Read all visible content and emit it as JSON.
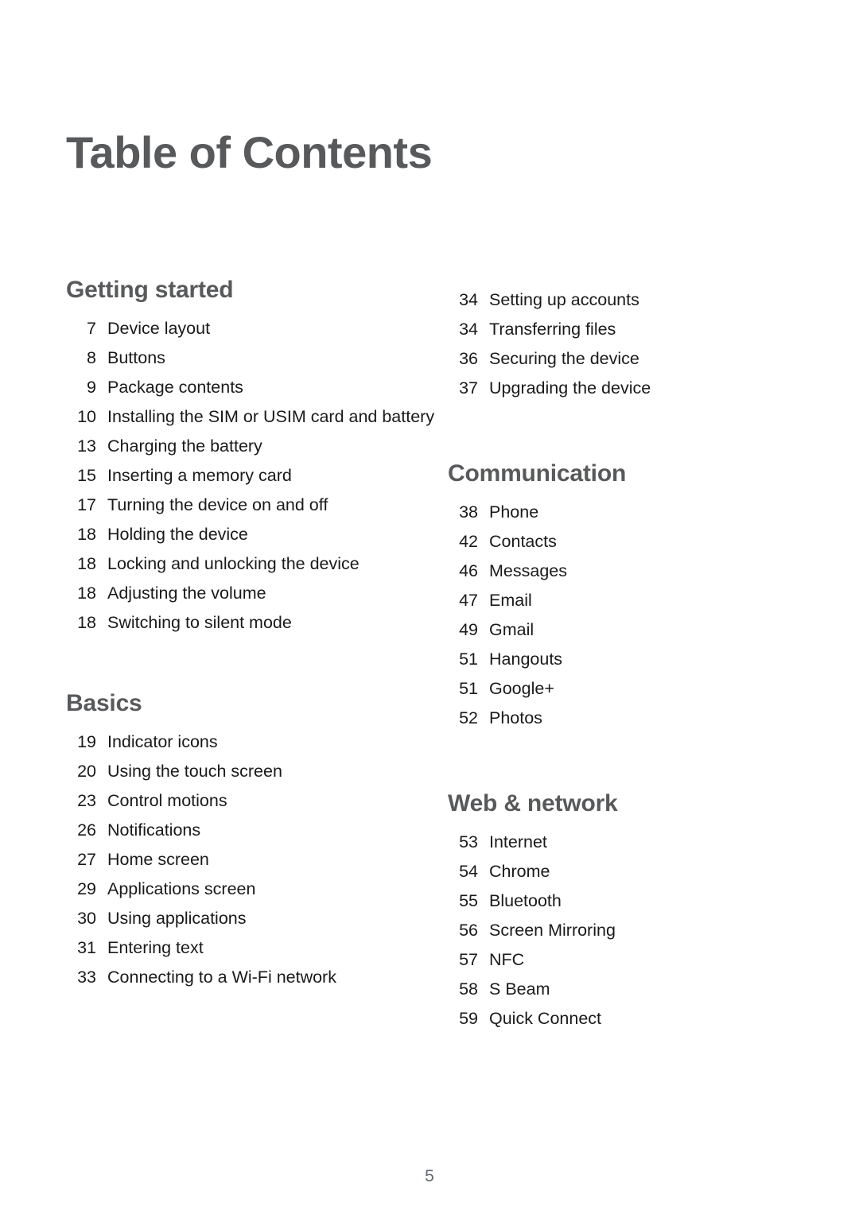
{
  "document": {
    "title": "Table of Contents",
    "page_number": "5",
    "colors": {
      "heading": "#58595b",
      "body": "#1a1a1a",
      "folio": "#5e6a6e",
      "background": "#ffffff"
    }
  },
  "left_column": {
    "sections": [
      {
        "heading": "Getting started",
        "entries": [
          {
            "page": "7",
            "title": "Device layout"
          },
          {
            "page": "8",
            "title": "Buttons"
          },
          {
            "page": "9",
            "title": "Package contents"
          },
          {
            "page": "10",
            "title": "Installing the SIM or USIM card and battery"
          },
          {
            "page": "13",
            "title": "Charging the battery"
          },
          {
            "page": "15",
            "title": "Inserting a memory card"
          },
          {
            "page": "17",
            "title": "Turning the device on and off"
          },
          {
            "page": "18",
            "title": "Holding the device"
          },
          {
            "page": "18",
            "title": "Locking and unlocking the device"
          },
          {
            "page": "18",
            "title": "Adjusting the volume"
          },
          {
            "page": "18",
            "title": "Switching to silent mode"
          }
        ]
      },
      {
        "heading": "Basics",
        "entries": [
          {
            "page": "19",
            "title": "Indicator icons"
          },
          {
            "page": "20",
            "title": "Using the touch screen"
          },
          {
            "page": "23",
            "title": "Control motions"
          },
          {
            "page": "26",
            "title": "Notifications"
          },
          {
            "page": "27",
            "title": "Home screen"
          },
          {
            "page": "29",
            "title": "Applications screen"
          },
          {
            "page": "30",
            "title": "Using applications"
          },
          {
            "page": "31",
            "title": "Entering text"
          },
          {
            "page": "33",
            "title": "Connecting to a Wi-Fi network"
          }
        ]
      }
    ]
  },
  "right_column": {
    "continued_entries": [
      {
        "page": "34",
        "title": "Setting up accounts"
      },
      {
        "page": "34",
        "title": "Transferring files"
      },
      {
        "page": "36",
        "title": "Securing the device"
      },
      {
        "page": "37",
        "title": "Upgrading the device"
      }
    ],
    "sections": [
      {
        "heading": "Communication",
        "entries": [
          {
            "page": "38",
            "title": "Phone"
          },
          {
            "page": "42",
            "title": "Contacts"
          },
          {
            "page": "46",
            "title": "Messages"
          },
          {
            "page": "47",
            "title": "Email"
          },
          {
            "page": "49",
            "title": "Gmail"
          },
          {
            "page": "51",
            "title": "Hangouts"
          },
          {
            "page": "51",
            "title": "Google+"
          },
          {
            "page": "52",
            "title": "Photos"
          }
        ]
      },
      {
        "heading": "Web & network",
        "entries": [
          {
            "page": "53",
            "title": "Internet"
          },
          {
            "page": "54",
            "title": "Chrome"
          },
          {
            "page": "55",
            "title": "Bluetooth"
          },
          {
            "page": "56",
            "title": "Screen Mirroring"
          },
          {
            "page": "57",
            "title": "NFC"
          },
          {
            "page": "58",
            "title": "S Beam"
          },
          {
            "page": "59",
            "title": "Quick Connect"
          }
        ]
      }
    ]
  }
}
